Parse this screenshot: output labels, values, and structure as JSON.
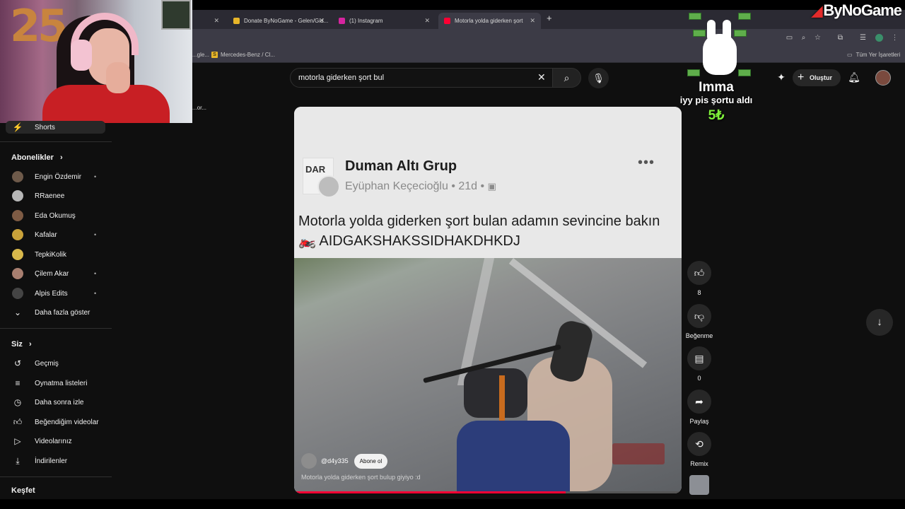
{
  "browser": {
    "tabs": [
      {
        "label": "Donate ByNoGame - Gelen/Gid...",
        "color": "#e7b529"
      },
      {
        "label": "(1) Instagram",
        "color": "#d6249f"
      },
      {
        "label": "Motorla yolda giderken şort",
        "color": "#ff0033"
      }
    ],
    "new_tab": "+",
    "bookmarks": [
      {
        "label": "...gle...",
        "icon": ""
      },
      {
        "label": "Mercedes-Benz / Cl...",
        "icon": "S"
      }
    ],
    "all_bookmarks": "Tüm Yer İşaretleri"
  },
  "webcam": {
    "number": "25"
  },
  "sidebar": {
    "stray_text": "...or...",
    "shorts": "Shorts",
    "subscriptions_title": "Abonelikler",
    "subscriptions": [
      {
        "label": "Engin Özdemir",
        "dot": "•",
        "color": "#6e5a4a"
      },
      {
        "label": "RRaenee",
        "dot": "",
        "color": "#b7b7b7"
      },
      {
        "label": "Eda Okumuş",
        "dot": "",
        "color": "#7e5b44"
      },
      {
        "label": "Kafalar",
        "dot": "•",
        "color": "#c9a23a"
      },
      {
        "label": "TepkiKolik",
        "dot": "",
        "color": "#d8b84b"
      },
      {
        "label": "Çilem Akar",
        "dot": "•",
        "color": "#a87f70"
      },
      {
        "label": "Alpis Edits",
        "dot": "•",
        "color": "#444444"
      }
    ],
    "show_more": "Daha fazla göster",
    "you_title": "Siz",
    "you_items": [
      {
        "label": "Geçmiş",
        "icon": "history-icon"
      },
      {
        "label": "Oynatma listeleri",
        "icon": "playlists-icon"
      },
      {
        "label": "Daha sonra izle",
        "icon": "watch-later-icon"
      },
      {
        "label": "Beğendiğim videolar",
        "icon": "liked-icon"
      },
      {
        "label": "Videolarınız",
        "icon": "your-videos-icon"
      },
      {
        "label": "İndirilenler",
        "icon": "downloads-icon"
      }
    ],
    "explore_title": "Keşfet"
  },
  "header": {
    "search_value": "motorla giderken şort bul",
    "create_label": "Oluştur"
  },
  "short": {
    "group_name": "Duman Altı Grup",
    "group_logo_text": "DAR",
    "author_line": "Eyüphan Keçecioğlu • 21d •",
    "post_text": "Motorla yolda giderken şort bulan adamın sevincine bakın 🏍️ AIDGAKSHAKSSIDHAKDHKDJ",
    "channel": "@d4y335",
    "subscribe": "Abone ol",
    "caption": "Motorla yolda giderken şort bulup giyiyo :d",
    "progress": 0.7
  },
  "actions": {
    "likes": "8",
    "dislike": "Beğenme",
    "comments": "0",
    "share": "Paylaş",
    "remix": "Remix"
  },
  "overlay": {
    "brand": "ByNoGame",
    "donor": "Imma",
    "message": "iyy pis şortu aldı",
    "amount": "5₺"
  }
}
